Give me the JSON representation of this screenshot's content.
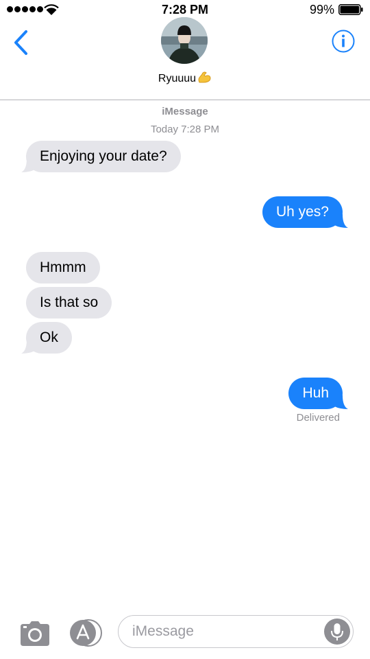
{
  "status_bar": {
    "time": "7:28 PM",
    "battery_percent": "99%",
    "signal_icon": "signal-dots-icon",
    "wifi_icon": "wifi-icon",
    "battery_icon": "battery-icon"
  },
  "header": {
    "back_icon": "chevron-left-icon",
    "contact_name": "Ryuuuu",
    "contact_emoji": "flexed-biceps-emoji",
    "info_icon": "info-icon"
  },
  "thread": {
    "service": "iMessage",
    "timestamp": "Today 7:28 PM",
    "messages": [
      {
        "direction": "incoming",
        "text": "Enjoying your date?"
      },
      {
        "direction": "outgoing",
        "text": "Uh yes?"
      },
      {
        "direction": "incoming",
        "text": "Hmmm"
      },
      {
        "direction": "incoming",
        "text": "Is that so"
      },
      {
        "direction": "incoming",
        "text": "Ok"
      },
      {
        "direction": "outgoing",
        "text": "Huh"
      }
    ],
    "delivery_status": "Delivered"
  },
  "compose": {
    "placeholder": "iMessage",
    "camera_icon": "camera-icon",
    "apps_icon": "app-store-icon",
    "mic_icon": "microphone-icon"
  },
  "colors": {
    "outgoing_bubble": "#1a82fb",
    "incoming_bubble": "#e5e5ea",
    "accent": "#1a82fb",
    "meta_text": "#8e8e93"
  }
}
